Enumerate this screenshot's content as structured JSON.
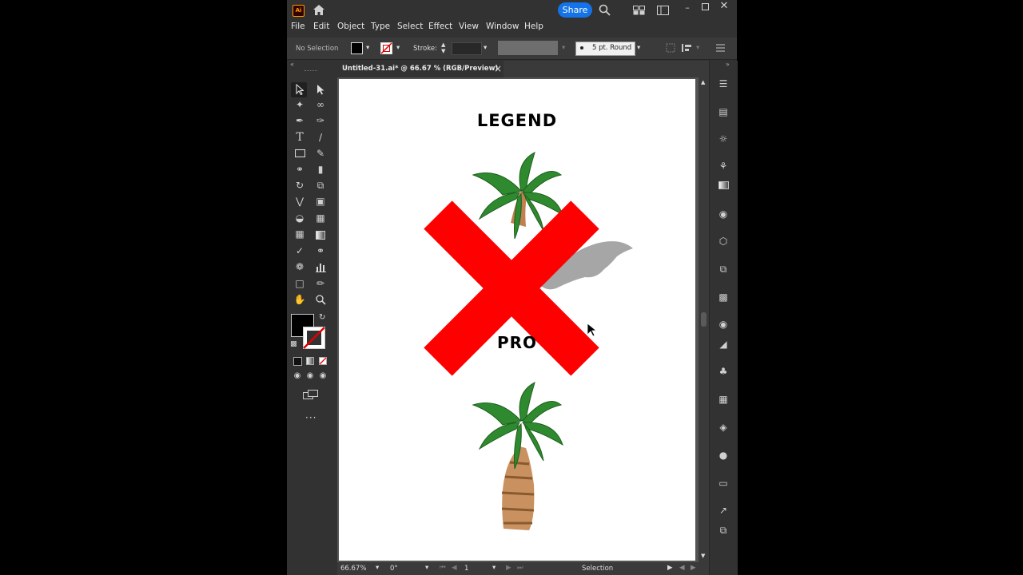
{
  "titlebar": {
    "app_icon": "Ai",
    "share_label": "Share"
  },
  "menu": [
    "File",
    "Edit",
    "Object",
    "Type",
    "Select",
    "Effect",
    "View",
    "Window",
    "Help"
  ],
  "control": {
    "selection_label": "No Selection",
    "stroke_label": "Stroke:",
    "brush_label": "5 pt. Round"
  },
  "document": {
    "tab_title": "Untitled-31.ai* @ 66.67 % (RGB/Preview)",
    "close": "×"
  },
  "artwork": {
    "heading": "LEGEND",
    "middle_text": "PRO"
  },
  "status": {
    "zoom": "66.67%",
    "rotation": "0°",
    "artboard": "1",
    "tool": "Selection"
  },
  "colors": {
    "accent": "#1473e6",
    "x_mark": "#ff0000",
    "chrome": "#323232"
  }
}
